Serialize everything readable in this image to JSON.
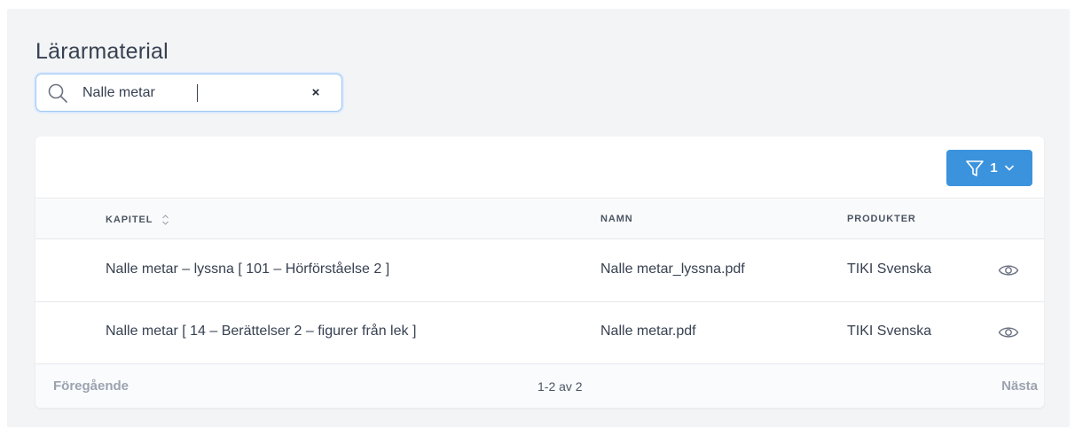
{
  "page": {
    "title": "Lärarmaterial"
  },
  "search": {
    "value": "Nalle metar",
    "clear_label": "×"
  },
  "filter": {
    "count": "1"
  },
  "table": {
    "columns": {
      "chapter": "KAPITEL",
      "name": "NAMN",
      "products": "PRODUKTER"
    },
    "rows": [
      {
        "chapter": "Nalle metar – lyssna [ 101 – Hörförståelse 2 ]",
        "name": "Nalle metar_lyssna.pdf",
        "product": "TIKI Svenska"
      },
      {
        "chapter": "Nalle metar [ 14 – Berättelser 2 – figurer från lek ]",
        "name": "Nalle metar.pdf",
        "product": "TIKI Svenska"
      }
    ]
  },
  "pagination": {
    "prev": "Föregående",
    "info": "1-2 av 2",
    "next": "Nästa"
  },
  "colors": {
    "accent": "#3b93dd",
    "muted": "#9ca3af",
    "background": "#f3f4f6"
  }
}
